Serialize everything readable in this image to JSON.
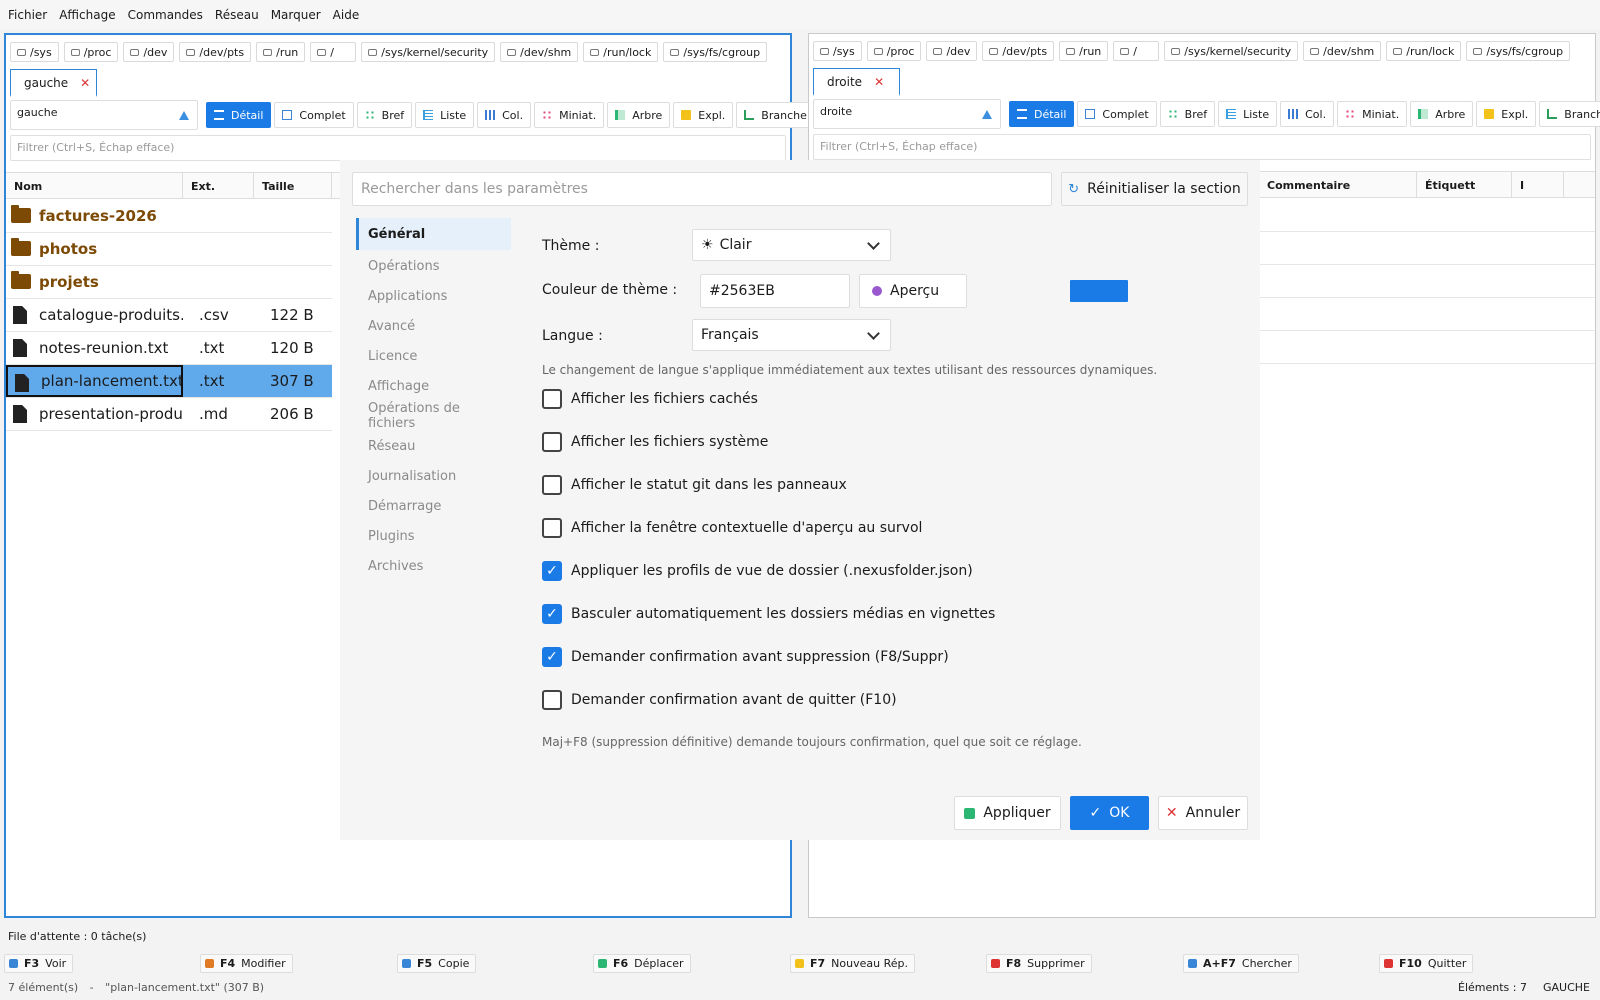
{
  "menu": [
    "Fichier",
    "Affichage",
    "Commandes",
    "Réseau",
    "Marquer",
    "Aide"
  ],
  "drives": [
    "/sys",
    "/proc",
    "/dev",
    "/dev/pts",
    "/run",
    "/",
    "/sys/kernel/security",
    "/dev/shm",
    "/run/lock",
    "/sys/fs/cgroup"
  ],
  "left": {
    "tab": "gauche",
    "path": "gauche",
    "filter_placeholder": "Filtrer (Ctrl+S, Échap efface)",
    "columns": [
      "Nom",
      "Ext.",
      "Taille"
    ],
    "rows": [
      {
        "name": "factures-2026",
        "ext": "",
        "size": "",
        "folder": true
      },
      {
        "name": "photos",
        "ext": "",
        "size": "",
        "folder": true
      },
      {
        "name": "projets",
        "ext": "",
        "size": "",
        "folder": true
      },
      {
        "name": "catalogue-produits.c",
        "ext": ".csv",
        "size": "122 B",
        "folder": false
      },
      {
        "name": "notes-reunion.txt",
        "ext": ".txt",
        "size": "120 B",
        "folder": false
      },
      {
        "name": "plan-lancement.txt",
        "ext": ".txt",
        "size": "307 B",
        "folder": false,
        "selected": true
      },
      {
        "name": "presentation-produit",
        "ext": ".md",
        "size": "206 B",
        "folder": false
      }
    ]
  },
  "right": {
    "tab": "droite",
    "path": "droite",
    "filter_placeholder": "Filtrer (Ctrl+S, Échap efface)",
    "columns": [
      "Commentaire",
      "Étiquett",
      "I"
    ]
  },
  "views": [
    "Détail",
    "Complet",
    "Bref",
    "Liste",
    "Col.",
    "Miniat.",
    "Arbre",
    "Expl.",
    "Branche"
  ],
  "dialog": {
    "search_placeholder": "Rechercher dans les paramètres",
    "reset": "Réinitialiser la section",
    "nav": [
      "Général",
      "Opérations",
      "Applications",
      "Avancé",
      "Licence",
      "Affichage",
      "Opérations de fichiers",
      "Réseau",
      "Journalisation",
      "Démarrage",
      "Plugins",
      "Archives"
    ],
    "theme_label": "Thème :",
    "theme_value": "Clair",
    "theme_icon": "☀",
    "color_label": "Couleur de thème :",
    "color_value": "#2563EB",
    "preview_label": "Aperçu",
    "swatch_color": "#1a7ae6",
    "lang_label": "Langue :",
    "lang_value": "Français",
    "lang_note": "Le changement de langue s'applique immédiatement aux textes utilisant des ressources dynamiques.",
    "checks": [
      {
        "label": "Afficher les fichiers cachés",
        "checked": false
      },
      {
        "label": "Afficher les fichiers système",
        "checked": false
      },
      {
        "label": "Afficher le statut git dans les panneaux",
        "checked": false
      },
      {
        "label": "Afficher la fenêtre contextuelle d'aperçu au survol",
        "checked": false
      },
      {
        "label": "Appliquer les profils de vue de dossier (.nexusfolder.json)",
        "checked": true
      },
      {
        "label": "Basculer automatiquement les dossiers médias en vignettes",
        "checked": true
      },
      {
        "label": "Demander confirmation avant suppression (F8/Suppr)",
        "checked": true
      },
      {
        "label": "Demander confirmation avant de quitter (F10)",
        "checked": false
      }
    ],
    "footnote": "Maj+F8 (suppression définitive) demande toujours confirmation, quel que soit ce réglage.",
    "apply": "Appliquer",
    "ok": "OK",
    "cancel": "Annuler"
  },
  "queue": "File d'attente : 0 tâche(s)",
  "fkeys": [
    {
      "key": "F3",
      "label": "Voir",
      "color": "#3a86d6"
    },
    {
      "key": "F4",
      "label": "Modifier",
      "color": "#e07b24"
    },
    {
      "key": "F5",
      "label": "Copie",
      "color": "#3a86d6"
    },
    {
      "key": "F6",
      "label": "Déplacer",
      "color": "#2bb673"
    },
    {
      "key": "F7",
      "label": "Nouveau Rép.",
      "color": "#f2c21a"
    },
    {
      "key": "F8",
      "label": "Supprimer",
      "color": "#d33"
    },
    {
      "key": "A+F7",
      "label": "Chercher",
      "color": "#3a86d6"
    },
    {
      "key": "F10",
      "label": "Quitter",
      "color": "#d33"
    }
  ],
  "status": {
    "count": "7 élément(s)",
    "sep": "-",
    "selection": "\"plan-lancement.txt\" (307 B)",
    "elements": "Éléments : 7",
    "side": "GAUCHE"
  }
}
